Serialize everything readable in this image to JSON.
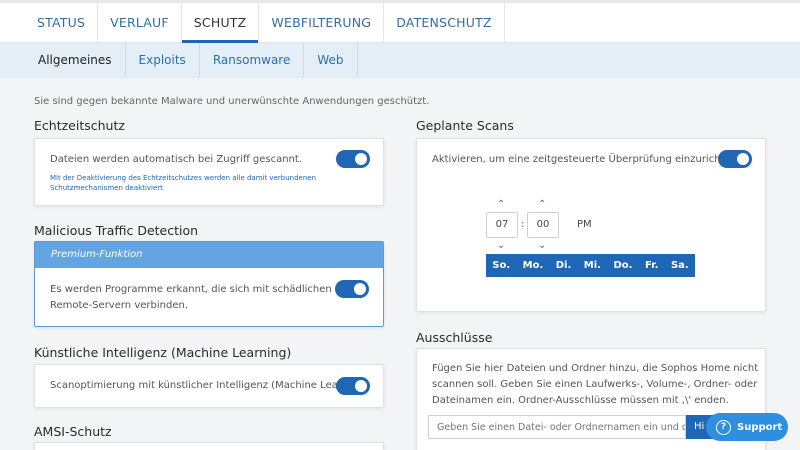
{
  "nav": {
    "tabs": [
      {
        "label": "STATUS"
      },
      {
        "label": "VERLAUF"
      },
      {
        "label": "SCHUTZ"
      },
      {
        "label": "WEBFILTERUNG"
      },
      {
        "label": "DATENSCHUTZ"
      }
    ],
    "subtabs": [
      {
        "label": "Allgemeines"
      },
      {
        "label": "Exploits"
      },
      {
        "label": "Ransomware"
      },
      {
        "label": "Web"
      }
    ]
  },
  "status_message": "Sie sind gegen bekannte Malware und unerwünschte Anwendungen geschützt.",
  "realtime": {
    "title": "Echtzeitschutz",
    "text": "Dateien werden automatisch bei Zugriff gescannt.",
    "note_line1": "Mit der Deaktivierung des Echtzeitschutzes werden alle damit verbundenen",
    "note_line2": "Schutzmechanismen deaktiviert"
  },
  "traffic": {
    "title": "Malicious Traffic Detection",
    "premium_label": "Premium-Funktion",
    "text_line1": "Es werden Programme erkannt, die sich mit schädlichen",
    "text_line2": "Remote-Servern verbinden."
  },
  "ml": {
    "title": "Künstliche Intelligenz (Machine Learning)",
    "text": "Scanoptimierung mit künstlicher Intelligenz (Machine Learning)."
  },
  "amsi": {
    "title": "AMSI-Schutz"
  },
  "scans": {
    "title": "Geplante Scans",
    "text": "Aktivieren, um eine zeitgesteuerte Überprüfung einzurichten.",
    "hour": "07",
    "separator": ":",
    "minute": "00",
    "period": "PM",
    "days": [
      "So.",
      "Mo.",
      "Di.",
      "Mi.",
      "Do.",
      "Fr.",
      "Sa."
    ]
  },
  "exclusions": {
    "title": "Ausschlüsse",
    "text_line1": "Fügen Sie hier Dateien und Ordner hinzu, die Sophos Home nicht",
    "text_line2": "scannen soll. Geben Sie einen Laufwerks-, Volume-, Ordner- oder",
    "text_line3": "Dateinamen ein. Ordner-Ausschlüsse müssen mit ,\\' enden.",
    "input_placeholder": "Geben Sie einen Datei- oder Ordnernamen ein und drück",
    "button_label": "Hi"
  },
  "support": {
    "icon": "question-icon",
    "label": "Support"
  },
  "colors": {
    "accent": "#1f66b5",
    "premium": "#63a4e3",
    "support": "#2e8fe0"
  }
}
